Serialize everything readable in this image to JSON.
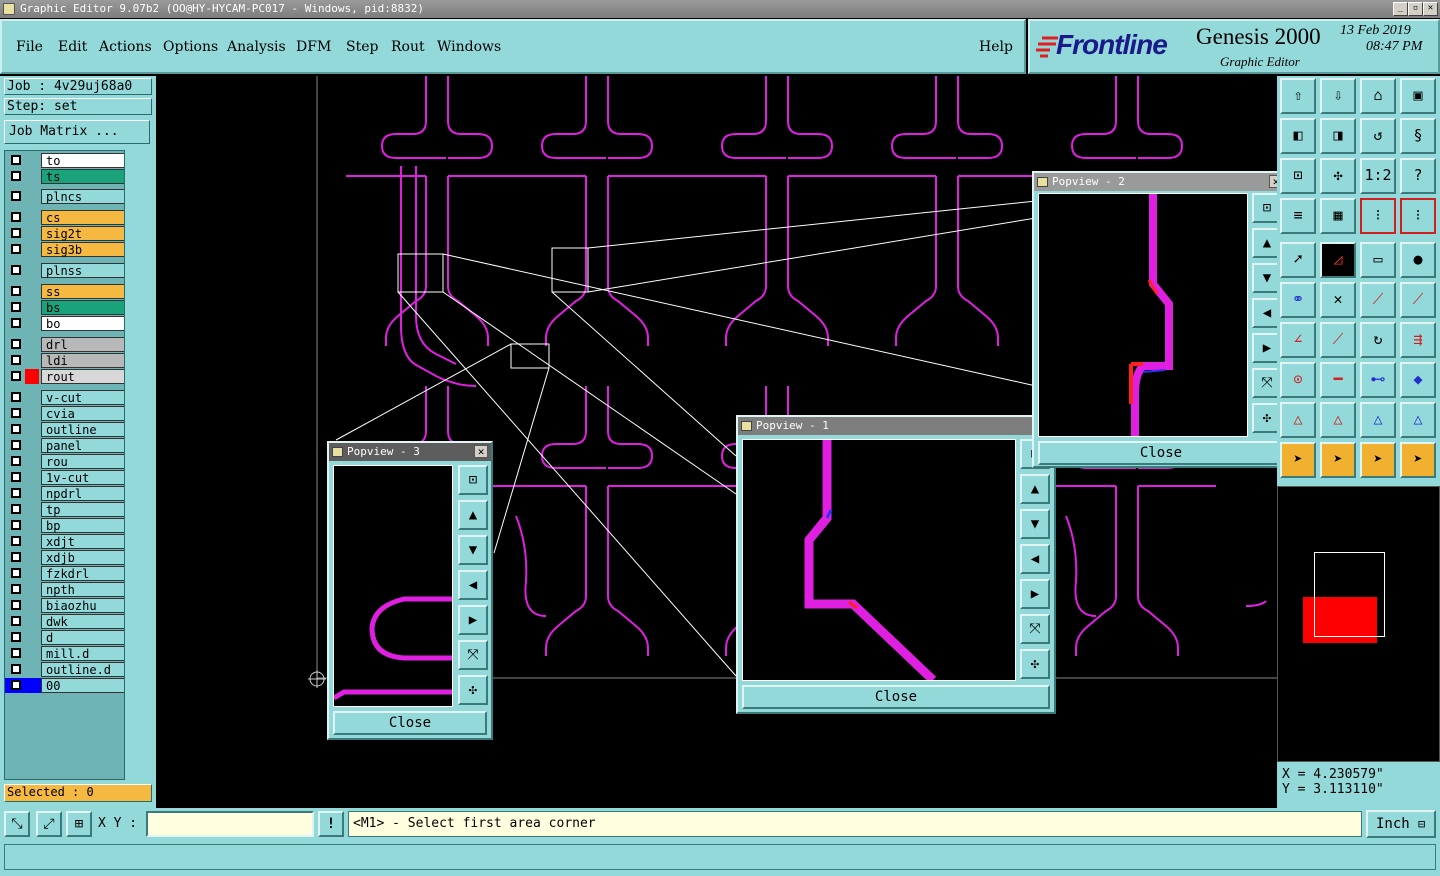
{
  "window": {
    "title": "Graphic Editor 9.07b2 (OO@HY-HYCAM-PC017 - Windows, pid:8832)",
    "min": "_",
    "max": "▫",
    "close": "✕"
  },
  "menu": {
    "file": "File",
    "edit": "Edit",
    "actions": "Actions",
    "options": "Options",
    "analysis": "Analysis",
    "dfm": "DFM",
    "step": "Step",
    "rout": "Rout",
    "windows": "Windows",
    "help": "Help"
  },
  "brand": {
    "logo": "Frontline",
    "product": "Genesis 2000",
    "subtitle": "Graphic Editor",
    "date": "13 Feb 2019",
    "time": "08:47 PM"
  },
  "left": {
    "job": "Job : 4v29uj68a0",
    "step": "Step: set",
    "job_matrix": "Job Matrix ...",
    "selected": "Selected : 0"
  },
  "layers": [
    {
      "name": "to",
      "color": "#ffffff"
    },
    {
      "name": "ts",
      "color": "#1aa37a"
    },
    {
      "name": "plncs",
      "color": "#93d9d9"
    },
    {
      "name": "cs",
      "color": "#f5b942"
    },
    {
      "name": "sig2t",
      "color": "#f5b942"
    },
    {
      "name": "sig3b",
      "color": "#f5b942"
    },
    {
      "name": "plnss",
      "color": "#93d9d9"
    },
    {
      "name": "ss",
      "color": "#f5b942"
    },
    {
      "name": "bs",
      "color": "#1aa37a"
    },
    {
      "name": "bo",
      "color": "#ffffff"
    },
    {
      "name": "drl",
      "color": "#b8b8b8"
    },
    {
      "name": "ldi",
      "color": "#b8b8b8"
    },
    {
      "name": "rout",
      "color": "#d8d8d8"
    },
    {
      "name": "v-cut",
      "color": "#93d9d9"
    },
    {
      "name": "cvia",
      "color": "#93d9d9"
    },
    {
      "name": "outline",
      "color": "#93d9d9"
    },
    {
      "name": "panel",
      "color": "#93d9d9"
    },
    {
      "name": "rou",
      "color": "#93d9d9"
    },
    {
      "name": "1v-cut",
      "color": "#93d9d9"
    },
    {
      "name": "npdrl",
      "color": "#93d9d9"
    },
    {
      "name": "tp",
      "color": "#93d9d9"
    },
    {
      "name": "bp",
      "color": "#93d9d9"
    },
    {
      "name": "xdjt",
      "color": "#93d9d9"
    },
    {
      "name": "xdjb",
      "color": "#93d9d9"
    },
    {
      "name": "fzkdrl",
      "color": "#93d9d9"
    },
    {
      "name": "npth",
      "color": "#93d9d9"
    },
    {
      "name": "biaozhu",
      "color": "#93d9d9"
    },
    {
      "name": "dwk",
      "color": "#93d9d9"
    },
    {
      "name": "d",
      "color": "#93d9d9"
    },
    {
      "name": "mill.d",
      "color": "#93d9d9"
    },
    {
      "name": "outline.d",
      "color": "#93d9d9"
    },
    {
      "name": "00",
      "color": "#93d9d9"
    }
  ],
  "popups": {
    "p1": {
      "title": "Popview - 1",
      "close": "Close"
    },
    "p2": {
      "title": "Popview - 2",
      "close": "Close"
    },
    "p3": {
      "title": "Popview - 3",
      "close": "Close"
    },
    "x": "✕"
  },
  "coords": {
    "x": "X = 4.230579\"",
    "y": "Y = 3.113110\""
  },
  "bottom": {
    "xy_label": "X Y :",
    "xy_value": "",
    "prompt": "<M1> - Select first area corner",
    "units": "Inch",
    "excl": "!"
  },
  "tools": {
    "one_to_two": "1:2",
    "help": "?"
  },
  "colors": {
    "panel": "#93d9d9",
    "trace": "#e020e0",
    "highlight": "#f0b030"
  }
}
